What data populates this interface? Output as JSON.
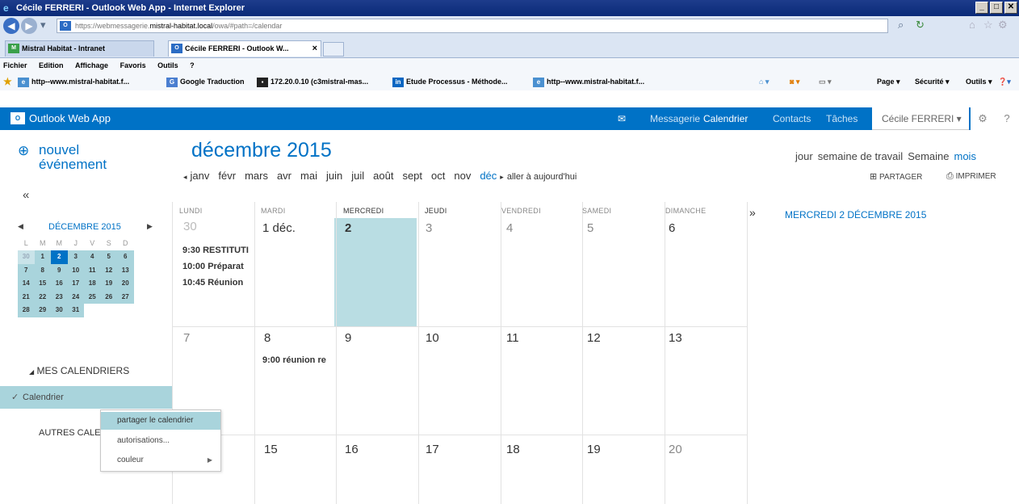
{
  "window": {
    "title": "Cécile FERRERI - Outlook Web App - Internet Explorer",
    "buttons": [
      "_",
      "□",
      "✕"
    ]
  },
  "address": {
    "prefix": "https://webmessagerie.",
    "host": "mistral-habitat.local",
    "path": "/owa/#path=/calendar"
  },
  "tabs": [
    {
      "label": "Mistral Habitat - Intranet"
    },
    {
      "label": "Cécile FERRERI - Outlook W...",
      "close": "×"
    }
  ],
  "menu": [
    "Fichier",
    "Edition",
    "Affichage",
    "Favoris",
    "Outils",
    "?"
  ],
  "favorites": [
    "http--www.mistral-habitat.f...",
    "Google Traduction",
    "172.20.0.10 (c3mistral-mas...",
    "Etude Processus - Méthode...",
    "http--www.mistral-habitat.f..."
  ],
  "commands": [
    "Page ▾",
    "Sécurité ▾",
    "Outils ▾"
  ],
  "owa": {
    "app_name": "Outlook Web App",
    "nav": [
      "Messagerie",
      "Calendrier",
      "Contacts",
      "Tâches"
    ],
    "user": "Cécile FERRERI ▾",
    "help": "?"
  },
  "new_event": {
    "line1": "nouvel",
    "line2": "événement"
  },
  "month_title": "décembre 2015",
  "months": [
    "janv",
    "févr",
    "mars",
    "avr",
    "mai",
    "juin",
    "juil",
    "août",
    "sept",
    "oct",
    "nov",
    "déc"
  ],
  "go_today": "aller à aujourd'hui",
  "views": [
    "jour",
    "semaine de travail",
    "Semaine",
    "mois"
  ],
  "share_label": "PARTAGER",
  "print_label": "IMPRIMER",
  "mini_calendar": {
    "title": "DÉCEMBRE 2015",
    "dows": [
      "L",
      "M",
      "M",
      "J",
      "V",
      "S",
      "D"
    ],
    "weeks": [
      [
        "30",
        "1",
        "2",
        "3",
        "4",
        "5",
        "6"
      ],
      [
        "7",
        "8",
        "9",
        "10",
        "11",
        "12",
        "13"
      ],
      [
        "14",
        "15",
        "16",
        "17",
        "18",
        "19",
        "20"
      ],
      [
        "21",
        "22",
        "23",
        "24",
        "25",
        "26",
        "27"
      ],
      [
        "28",
        "29",
        "30",
        "31",
        "",
        "",
        ""
      ]
    ]
  },
  "my_calendars_title": "MES CALENDRIERS",
  "calendar_item": "Calendrier",
  "other_calendars": "AUTRES CALEN",
  "context_menu": [
    "partager le calendrier",
    "autorisations...",
    "couleur"
  ],
  "grid": {
    "dows": [
      "LUNDI",
      "MARDI",
      "MERCREDI",
      "JEUDI",
      "VENDREDI",
      "SAMEDI",
      "DIMANCHE"
    ],
    "week1": [
      "30",
      "1 déc.",
      "2",
      "3",
      "4",
      "5",
      "6"
    ],
    "week2": [
      "7",
      "8",
      "9",
      "10",
      "11",
      "12",
      "13"
    ],
    "week3": [
      "15",
      "16",
      "17",
      "18",
      "19",
      "20"
    ],
    "events_mon30": [
      "9:30 RESTITUTI",
      "10:00 Préparat",
      "10:45 Réunion"
    ],
    "events_tue8": [
      "9:00 réunion re"
    ]
  },
  "agenda_title": "MERCREDI 2 DÉCEMBRE 2015",
  "colors": {
    "owa_blue": "#0072c6",
    "teal_highlight": "#a9d4dc"
  }
}
